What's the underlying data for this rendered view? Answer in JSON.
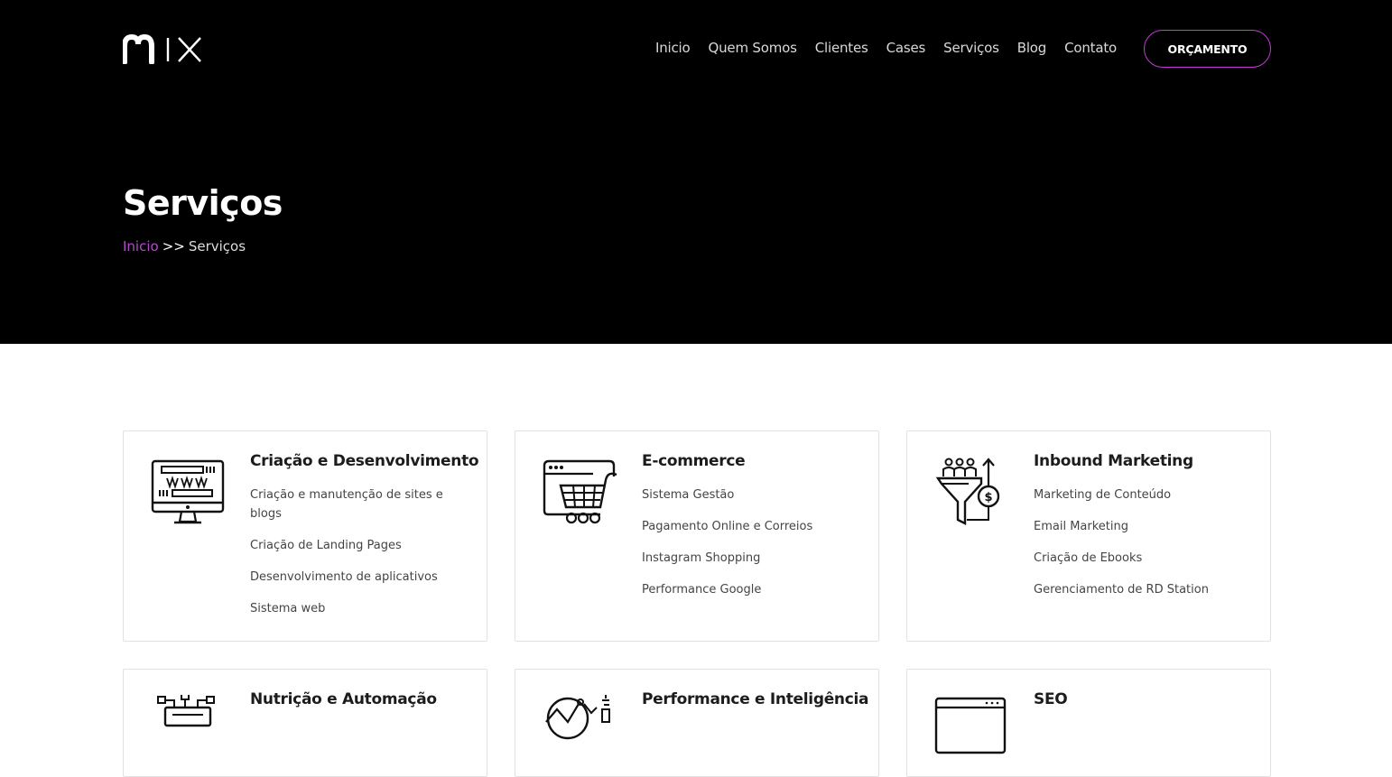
{
  "brand": {
    "logo_text": "mix",
    "accent_color": "#c23bd4",
    "breadcrumb_color": "#b54ac9"
  },
  "nav": {
    "items": [
      "Inicio",
      "Quem Somos",
      "Clientes",
      "Cases",
      "Serviços",
      "Blog",
      "Contato"
    ],
    "cta_label": "ORÇAMENTO"
  },
  "hero": {
    "title": "Serviços",
    "breadcrumb": {
      "home": "Inicio",
      "separator": ">>",
      "current": "Serviços"
    }
  },
  "services": [
    {
      "title": "Criação e Desenvolvimento",
      "icon": "monitor-www-icon",
      "items": [
        "Criação e manutenção de sites e blogs",
        "Criação de Landing Pages",
        "Desenvolvimento de aplicativos",
        "Sistema web"
      ]
    },
    {
      "title": "E-commerce",
      "icon": "shopping-cart-browser-icon",
      "items": [
        "Sistema Gestão",
        "Pagamento Online e Correios",
        "Instagram Shopping",
        "Performance Google"
      ]
    },
    {
      "title": "Inbound Marketing",
      "icon": "funnel-dollar-icon",
      "items": [
        "Marketing de Conteúdo",
        "Email Marketing",
        "Criação de Ebooks",
        "Gerenciamento de RD Station"
      ]
    },
    {
      "title": "Nutrição e Automação",
      "icon": "automation-network-icon",
      "items": []
    },
    {
      "title": "Performance e Inteligência",
      "icon": "analytics-chart-icon",
      "items": []
    },
    {
      "title": "SEO",
      "icon": "browser-seo-icon",
      "items": []
    }
  ]
}
